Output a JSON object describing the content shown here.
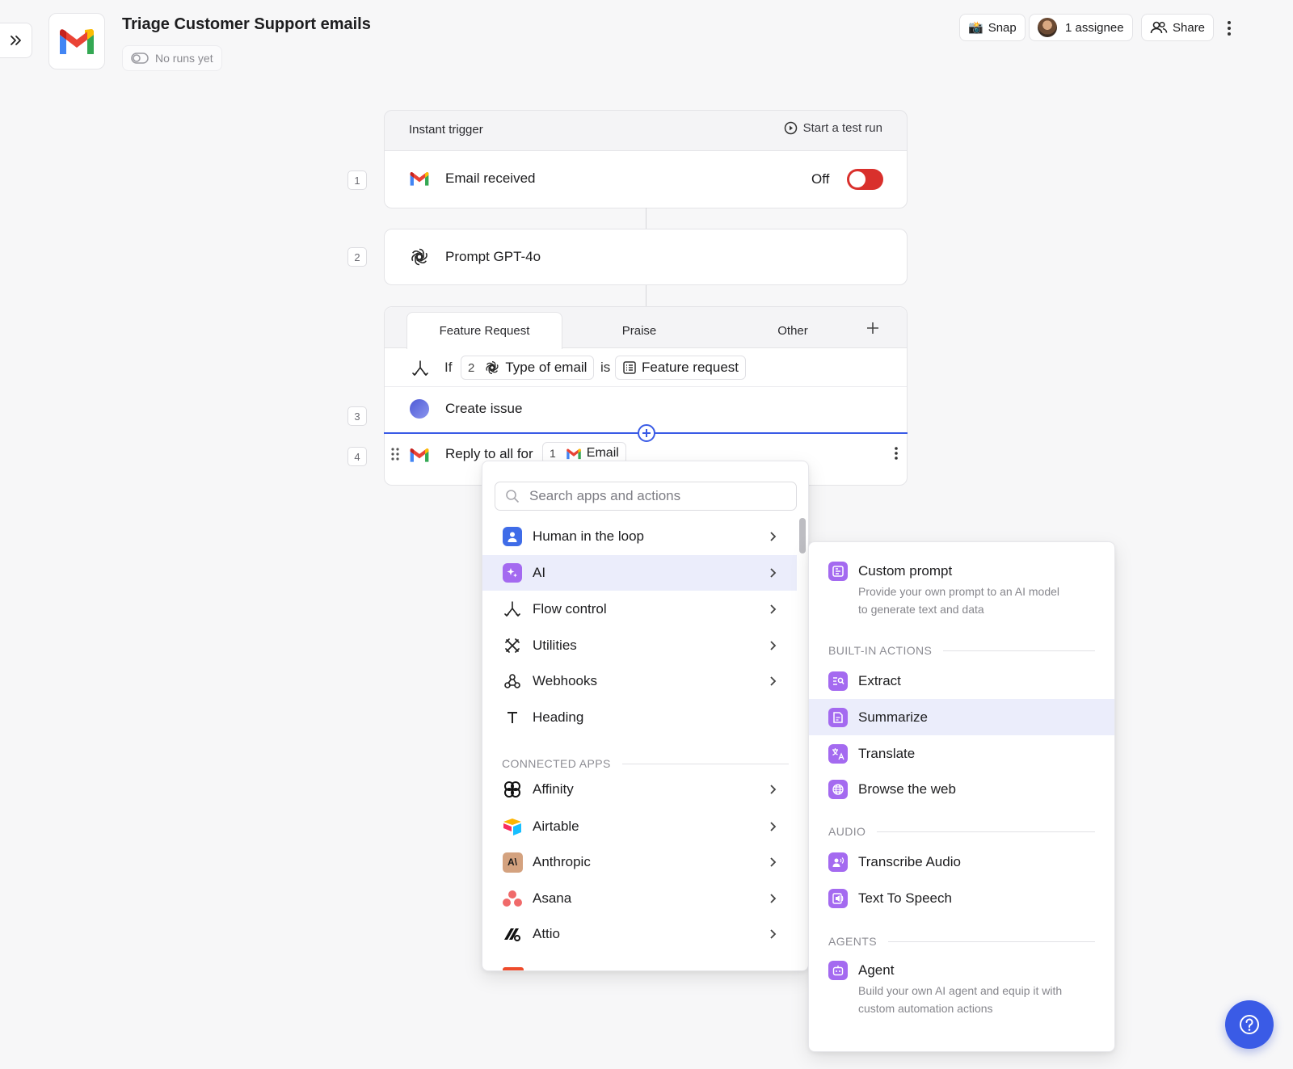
{
  "header": {
    "title": "Triage Customer Support emails",
    "runs_status": "No runs yet",
    "snap_label": "Snap",
    "assignee_label": "1 assignee",
    "share_label": "Share"
  },
  "trigger": {
    "section_label": "Instant trigger",
    "test_run_label": "Start a test run",
    "step_number": "1",
    "label": "Email received",
    "toggle_state": "Off"
  },
  "step2": {
    "number": "2",
    "label": "Prompt GPT-4o"
  },
  "branch": {
    "tabs": [
      "Feature Request",
      "Praise",
      "Other"
    ],
    "condition": {
      "if_word": "If",
      "ref_step": "2",
      "field": "Type of email",
      "is_word": "is",
      "value": "Feature request"
    }
  },
  "step3": {
    "number": "3",
    "label": "Create issue"
  },
  "step4": {
    "number": "4",
    "label": "Reply to all for",
    "ref_step": "1",
    "ref_field": "Email"
  },
  "menu": {
    "search_placeholder": "Search apps and actions",
    "items": [
      {
        "label": "Human in the loop",
        "icon": "person-icon"
      },
      {
        "label": "AI",
        "icon": "sparkle-icon"
      },
      {
        "label": "Flow control",
        "icon": "branch-icon"
      },
      {
        "label": "Utilities",
        "icon": "tools-icon"
      },
      {
        "label": "Webhooks",
        "icon": "webhook-icon"
      },
      {
        "label": "Heading",
        "icon": "text-icon"
      }
    ],
    "connected_apps_header": "CONNECTED APPS",
    "apps": [
      {
        "label": "Affinity",
        "icon": "affinity-icon"
      },
      {
        "label": "Airtable",
        "icon": "airtable-icon"
      },
      {
        "label": "Anthropic",
        "icon": "anthropic-icon"
      },
      {
        "label": "Asana",
        "icon": "asana-icon"
      },
      {
        "label": "Attio",
        "icon": "attio-icon"
      }
    ]
  },
  "submenu": {
    "custom_prompt": {
      "title": "Custom prompt",
      "desc_line1": "Provide your own prompt to an AI model",
      "desc_line2": "to generate text and data"
    },
    "builtin_header": "BUILT-IN ACTIONS",
    "builtin": [
      "Extract",
      "Summarize",
      "Translate",
      "Browse the web"
    ],
    "audio_header": "AUDIO",
    "audio": [
      "Transcribe Audio",
      "Text To Speech"
    ],
    "agents_header": "AGENTS",
    "agent": {
      "title": "Agent",
      "desc_line1": "Build your own AI agent and equip it with",
      "desc_line2": "custom automation actions"
    }
  },
  "colors": {
    "accent": "#3a5be6",
    "toggle_off": "#d9302c",
    "ai_purple": "#a46af0",
    "highlight": "#ebedfb"
  }
}
